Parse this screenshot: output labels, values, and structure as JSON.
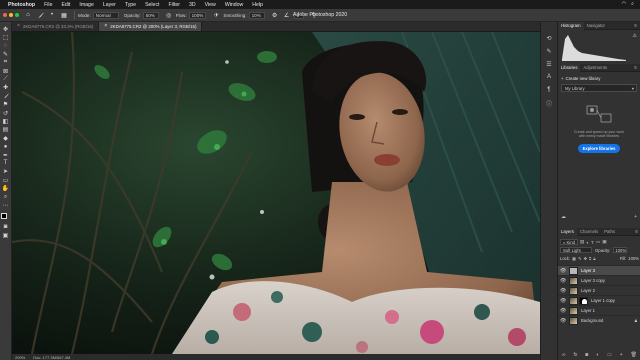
{
  "menubar": {
    "app": "Photoshop",
    "items": [
      "File",
      "Edit",
      "Image",
      "Layer",
      "Type",
      "Select",
      "Filter",
      "3D",
      "View",
      "Window",
      "Help"
    ]
  },
  "window": {
    "title": "Adobe Photoshop 2020"
  },
  "options": {
    "mode_label": "Mode:",
    "mode_value": "Normal",
    "opacity_label": "Opacity:",
    "opacity_value": "50%",
    "flow_label": "Flow:",
    "flow_value": "100%",
    "smoothing_label": "Smoothing:",
    "smoothing_value": "10%",
    "angle_value": "0°"
  },
  "tabs": [
    {
      "label": "2KDA8775.CR2 @ 33.3% (RGB/16)",
      "active": false
    },
    {
      "label": "2KDA8775.CR2 @ 200% (Layer 3, RGB/16)",
      "active": true
    }
  ],
  "status": {
    "zoom": "200%",
    "doc": "Doc: 177.3M/567.4M"
  },
  "panels": {
    "top_tabs": [
      "Histogram",
      "Navigator"
    ],
    "mid_tabs": [
      "Libraries",
      "Adjustments"
    ],
    "create_library": "Create new library",
    "my_library": "My Library",
    "library_message": "Create and speed up your work with newly made libraries",
    "explore_button": "Explore libraries",
    "layer_tabs": [
      "Layers",
      "Channels",
      "Paths"
    ]
  },
  "layers": {
    "kind": "Kind",
    "blend_mode": "Soft Light",
    "opacity_label": "Opacity:",
    "opacity_value": "100%",
    "lock_label": "Lock:",
    "fill_label": "Fill:",
    "fill_value": "100%",
    "list": [
      {
        "name": "Layer 3",
        "active": true,
        "thumb": "plain",
        "mask": false,
        "locked": false
      },
      {
        "name": "Layer 3 copy",
        "active": false,
        "thumb": "image",
        "mask": false,
        "locked": false
      },
      {
        "name": "Layer 2",
        "active": false,
        "thumb": "image",
        "mask": false,
        "locked": false
      },
      {
        "name": "Layer 1 copy",
        "active": false,
        "thumb": "image",
        "mask": true,
        "locked": false
      },
      {
        "name": "Layer 1",
        "active": false,
        "thumb": "image",
        "mask": false,
        "locked": false
      },
      {
        "name": "Background",
        "active": false,
        "thumb": "image",
        "mask": false,
        "locked": true
      }
    ]
  },
  "colors": {
    "accent": "#1473e6",
    "panel": "#323232",
    "foreground_swatch": "#000000",
    "background_swatch": "#b30c0c"
  }
}
